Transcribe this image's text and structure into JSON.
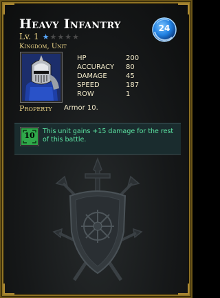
{
  "card": {
    "title": "Heavy Infantry",
    "cost": "24",
    "level_label": "Lv. 1",
    "level": 1,
    "max_level": 5,
    "subtitle": "Kingdom, Unit",
    "portrait_icon": "knight-portrait-icon",
    "stats": [
      {
        "label": "HP",
        "value": "200"
      },
      {
        "label": "ACCURACY",
        "value": "80"
      },
      {
        "label": "DAMAGE",
        "value": "45"
      },
      {
        "label": "SPEED",
        "value": "187"
      },
      {
        "label": "ROW",
        "value": "1"
      }
    ],
    "property_label": "Property",
    "property_value": "Armor 10.",
    "ability": {
      "icon_value": "10",
      "icon_color": "#2fa84a",
      "text": "This unit gains +15 damage for the rest of this battle."
    },
    "emblem_icon": "kingdom-shield-emblem-icon",
    "colors": {
      "gold_text": "#f0d88a",
      "ability_text": "#5de6a4",
      "star_on": "#58a8ff",
      "cost_orb": "#1f7fe0"
    }
  }
}
